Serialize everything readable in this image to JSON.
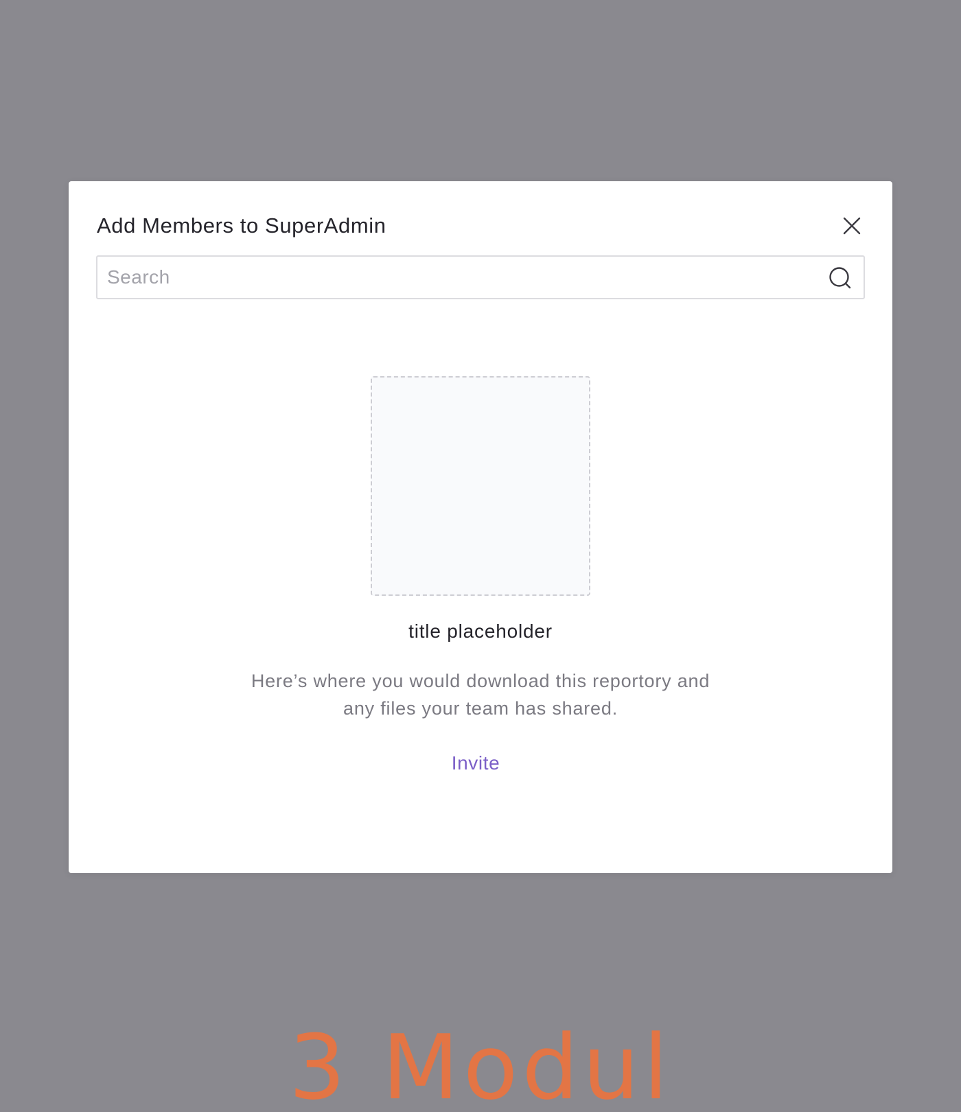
{
  "background": {
    "heading_fragment": "3 Modul"
  },
  "modal": {
    "title": "Add Members to SuperAdmin",
    "close_icon": "close-icon",
    "search": {
      "placeholder": "Search",
      "value": "",
      "icon": "search-icon"
    },
    "empty_state": {
      "title": "title placeholder",
      "description": "Here’s where you would download this reportory and any files your team has shared.",
      "invite_label": "Invite"
    }
  },
  "colors": {
    "overlay": "#8a898f",
    "accent": "#7b5fc7",
    "background_heading": "#e37545",
    "text_primary": "#25242b",
    "text_secondary": "#7b7a82"
  }
}
